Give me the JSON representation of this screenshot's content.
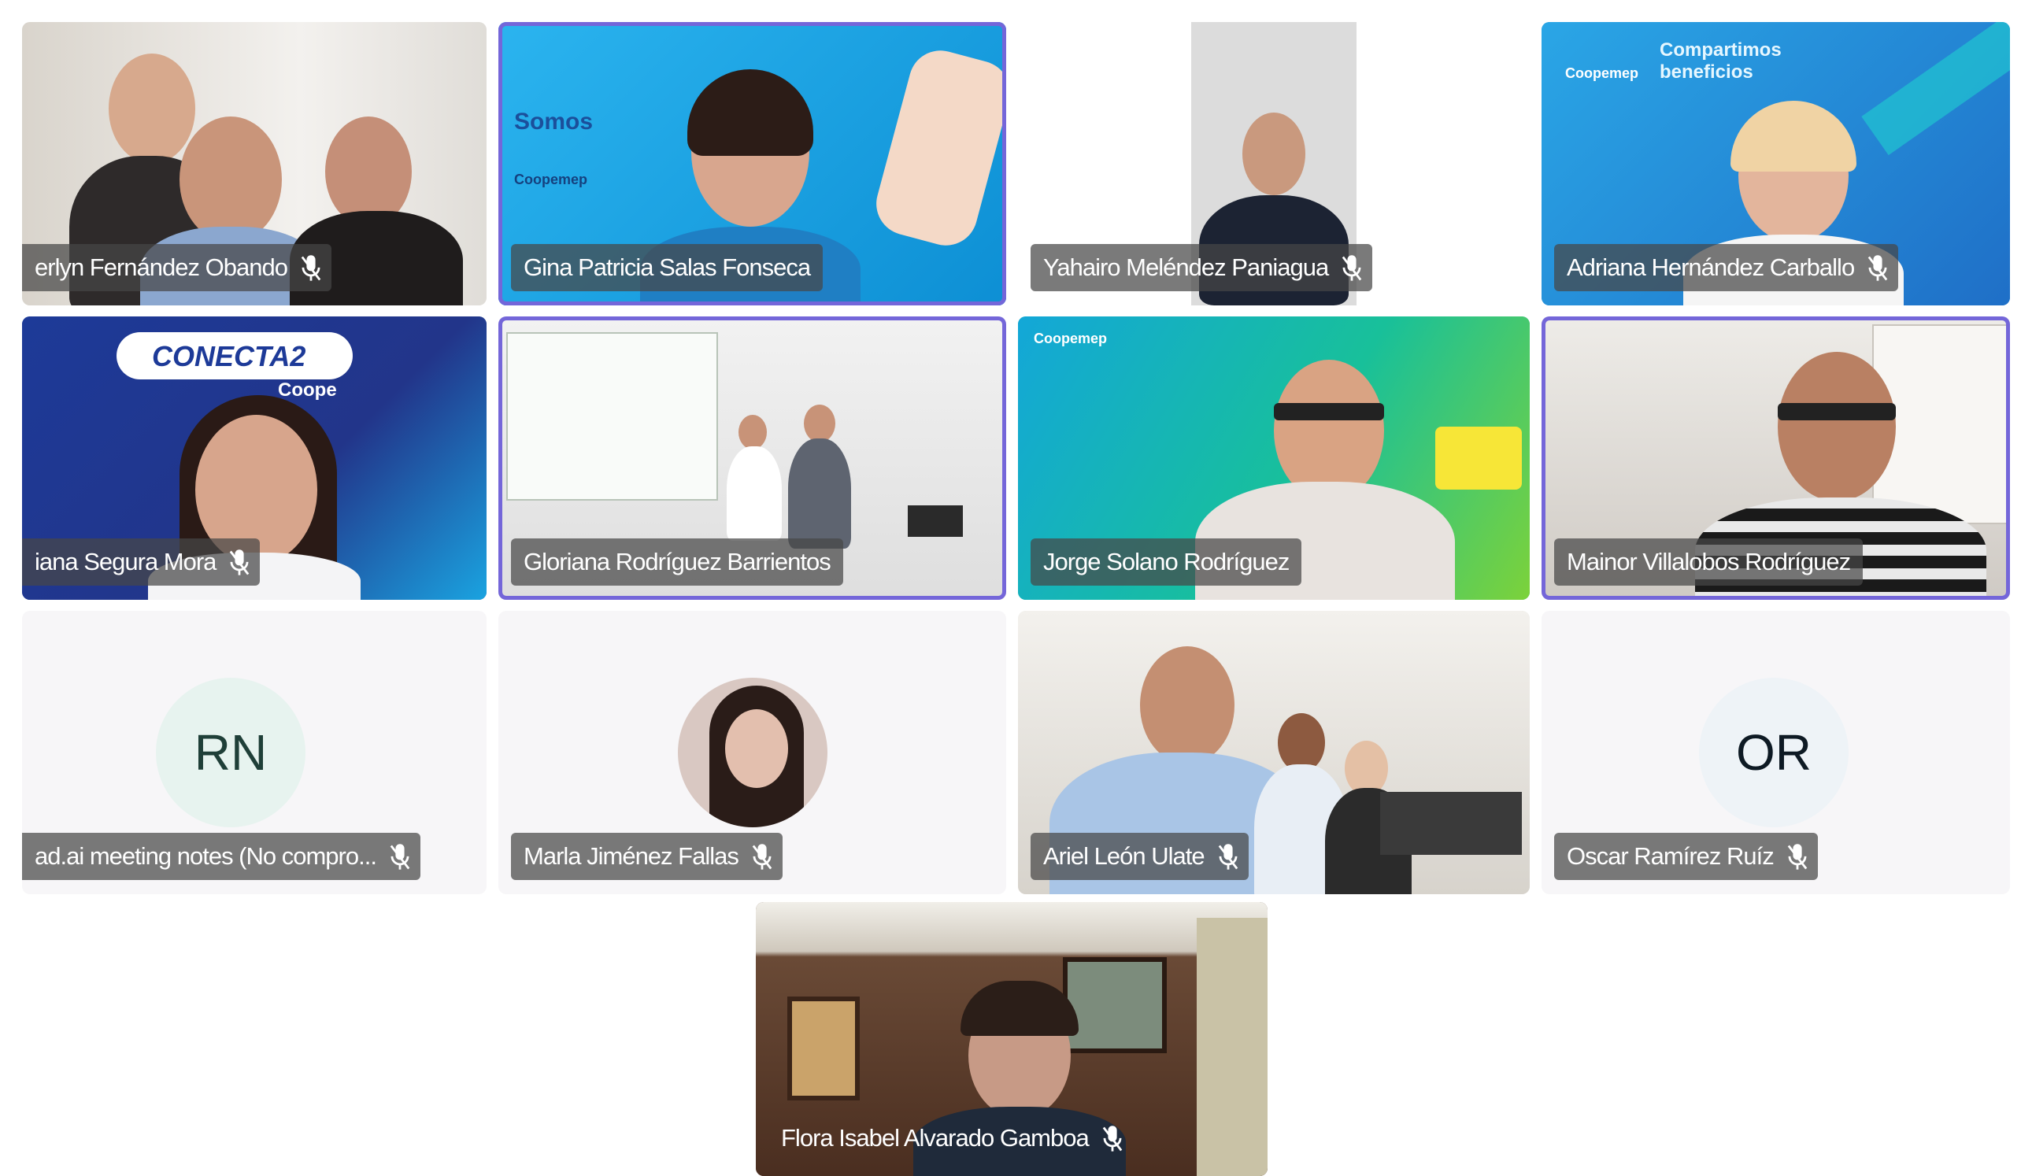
{
  "participants": [
    {
      "name": "erlyn Fernández Obando",
      "avatar": "",
      "muted": true
    },
    {
      "name": "Gina Patricia Salas Fonseca",
      "avatar": "",
      "muted": false
    },
    {
      "name": "Yahairo Meléndez Paniagua",
      "avatar": "",
      "muted": true
    },
    {
      "name": "Adriana Hernández Carballo",
      "avatar": "",
      "muted": true
    },
    {
      "name": "iana Segura Mora",
      "avatar": "",
      "muted": true
    },
    {
      "name": "Gloriana Rodríguez Barrientos",
      "avatar": "",
      "muted": false
    },
    {
      "name": "Jorge Solano Rodríguez",
      "avatar": "",
      "muted": false
    },
    {
      "name": "Mainor Villalobos Rodríguez",
      "avatar": "",
      "muted": false
    },
    {
      "name": "ad.ai meeting notes (No compro...",
      "avatar": "RN",
      "muted": true
    },
    {
      "name": "Marla Jiménez Fallas",
      "avatar": "",
      "muted": true
    },
    {
      "name": "Ariel León Ulate",
      "avatar": "",
      "muted": true
    },
    {
      "name": "Oscar Ramírez Ruíz",
      "avatar": "OR",
      "muted": true
    },
    {
      "name": "Flora Isabel Alvarado Gamboa",
      "avatar": "",
      "muted": true
    }
  ],
  "backgrounds": {
    "gina_banner_1": "Somos",
    "gina_banner_2": "Coopemep",
    "adriana_banner_1": "Compartimos",
    "adriana_banner_2": "beneficios",
    "adriana_logo": "Coopemep",
    "iana_banner": "CONECTA2",
    "iana_sub": "Coope",
    "jorge_logo": "Coopemep"
  },
  "colors": {
    "speaking_border": "#7466d9",
    "namebar_bg": "#464646"
  }
}
